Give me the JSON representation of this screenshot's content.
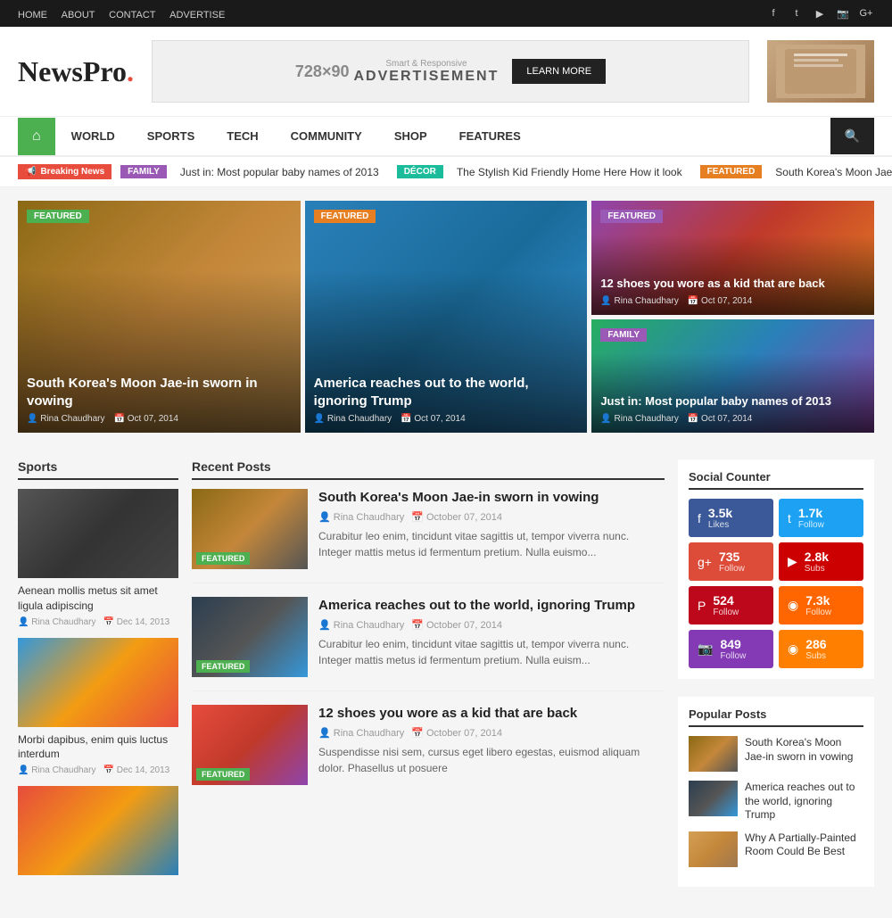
{
  "topbar": {
    "nav": [
      "HOME",
      "ABOUT",
      "CONTACT",
      "ADVERTISE"
    ],
    "socials": [
      "f",
      "t",
      "▶",
      "📷",
      "g+"
    ]
  },
  "header": {
    "logo": "NewsPro",
    "ad": {
      "size": "728×90",
      "label": "Smart & Responsive",
      "text": "ADVERTISEMENT",
      "btn": "LEARN MORE"
    }
  },
  "nav": {
    "home_icon": "⌂",
    "links": [
      "WORLD",
      "SPORTS",
      "TECH",
      "COMMUNITY",
      "SHOP",
      "FEATURES"
    ],
    "search_icon": "🔍"
  },
  "breaking": {
    "label": "Breaking News",
    "items": [
      {
        "tag": "FAMILY",
        "tag_class": "tag-family",
        "text": "Just in: Most popular baby names of 2013"
      },
      {
        "tag": "DÉCOR",
        "tag_class": "tag-decor",
        "text": "The Stylish Kid Friendly Home Here How it look"
      },
      {
        "tag": "FEATURED",
        "tag_class": "tag-featured",
        "text": "South Korea's Moon Jae-in sworn in v"
      }
    ]
  },
  "featured": {
    "items": [
      {
        "tag": "FEATURED",
        "tag_class": "feat-tag-green",
        "img_class": "img-trump",
        "title": "South Korea's Moon Jae-in sworn in vowing",
        "author": "Rina Chaudhary",
        "date": "Oct 07, 2014"
      },
      {
        "tag": "FEATURED",
        "tag_class": "feat-tag-orange",
        "img_class": "img-macron",
        "title": "America reaches out to the world, ignoring Trump",
        "author": "Rina Chaudhary",
        "date": "Oct 07, 2014"
      }
    ],
    "right": [
      {
        "tag": "FEATURED",
        "tag_class": "feat-tag-purple",
        "img_class": "img-woman",
        "title": "12 shoes you wore as a kid that are back",
        "author": "Rina Chaudhary",
        "date": "Oct 07, 2014"
      },
      {
        "tag": "FAMILY",
        "tag_class": "feat-tag-purple",
        "img_class": "img-hillary",
        "title": "Just in: Most popular baby names of 2013",
        "author": "Rina Chaudhary",
        "date": "Oct 07, 2014"
      }
    ]
  },
  "sports": {
    "title": "Sports",
    "items": [
      {
        "img_class": "img-sport",
        "title": "Aenean mollis metus sit amet ligula adipiscing",
        "author": "Rina Chaudhary",
        "date": "Dec 14, 2013"
      },
      {
        "img_class": "img-beach",
        "title": "Morbi dapibus, enim quis luctus interdum",
        "author": "Rina Chaudhary",
        "date": "Dec 14, 2013"
      },
      {
        "img_class": "img-crowd",
        "title": "",
        "author": "",
        "date": ""
      }
    ]
  },
  "recent": {
    "title": "Recent Posts",
    "items": [
      {
        "tag": "FEATURED",
        "img_class": "img-trump2",
        "title": "South Korea's Moon Jae-in sworn in vowing",
        "author": "Rina Chaudhary",
        "date": "October 07, 2014",
        "excerpt": "Curabitur leo enim, tincidunt vitae sagittis ut, tempor viverra nunc. Integer mattis metus id fermentum pretium. Nulla euismo..."
      },
      {
        "tag": "FEATURED",
        "img_class": "img-macron3",
        "title": "America reaches out to the world, ignoring Trump",
        "author": "Rina Chaudhary",
        "date": "October 07, 2014",
        "excerpt": "Curabitur leo enim, tincidunt vitae sagittis ut, tempor viverra nunc. Integer mattis metus id fermentum pretium. Nulla euism..."
      },
      {
        "tag": "FEATURED",
        "img_class": "img-girl",
        "title": "12 shoes you wore as a kid that are back",
        "author": "Rina Chaudhary",
        "date": "October 07, 2014",
        "excerpt": "Suspendisse nisi sem, cursus eget libero egestas, euismod aliquam dolor. Phasellus ut posuere"
      }
    ]
  },
  "social_counter": {
    "title": "Social Counter",
    "items": [
      {
        "platform": "Facebook",
        "icon": "f",
        "count": "3.5k",
        "label": "Likes",
        "class": "sc-fb"
      },
      {
        "platform": "Twitter",
        "icon": "t",
        "count": "1.7k",
        "label": "Follow",
        "class": "sc-tw"
      },
      {
        "platform": "Google+",
        "icon": "g+",
        "count": "735",
        "label": "Follow",
        "class": "sc-gp"
      },
      {
        "platform": "YouTube",
        "icon": "▶",
        "count": "2.8k",
        "label": "Subs",
        "class": "sc-yt"
      },
      {
        "platform": "Pinterest",
        "icon": "P",
        "count": "524",
        "label": "Follow",
        "class": "sc-pi"
      },
      {
        "platform": "RSS",
        "icon": "◉",
        "count": "7.3k",
        "label": "Follow",
        "class": "sc-rs"
      },
      {
        "platform": "Instagram",
        "icon": "📷",
        "count": "849",
        "label": "Follow",
        "class": "sc-ig"
      },
      {
        "platform": "RSS2",
        "icon": "◉",
        "count": "286",
        "label": "Subs",
        "class": "sc-rs2"
      }
    ]
  },
  "popular_posts": {
    "title": "Popular Posts",
    "items": [
      {
        "img_class": "img-trump2",
        "title": "South Korea's Moon Jae-in sworn in vowing"
      },
      {
        "img_class": "img-macron3",
        "title": "America reaches out to the world, ignoring Trump"
      },
      {
        "img_class": "img-room",
        "title": "Why A Partially-Painted Room Could Be Best"
      }
    ]
  }
}
